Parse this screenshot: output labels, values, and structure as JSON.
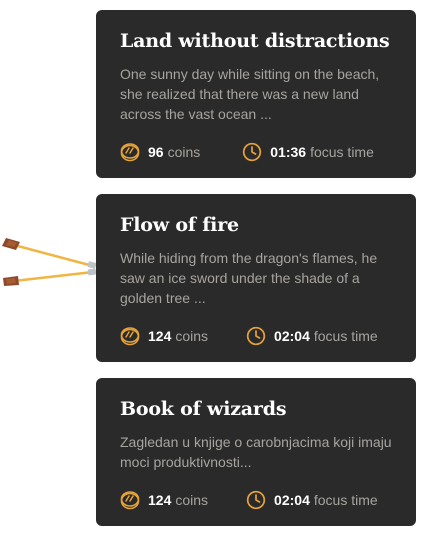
{
  "colors": {
    "card_background": "#2b2a2a",
    "title": "#ffffff",
    "description": "#a6a4a0",
    "accent_icon": "#e5a33a",
    "arrow_shaft": "#f0b542",
    "arrow_fletching": "#8b4a2b"
  },
  "decoration": {
    "icon": "arrows-icon"
  },
  "cards": [
    {
      "title": "Land without distractions",
      "description": "One sunny day while sitting on the beach, she realized that there was a new land across the vast ocean ...",
      "coins_value": "96",
      "coins_label": "coins",
      "coins_icon": "coin-icon",
      "time_value": "01:36",
      "time_label": "focus time",
      "time_icon": "clock-icon"
    },
    {
      "title": "Flow of fire",
      "description": "While hiding from the dragon's flames, he saw an ice sword under the shade of a golden tree ...",
      "coins_value": "124",
      "coins_label": "coins",
      "coins_icon": "coin-icon",
      "time_value": "02:04",
      "time_label": "focus time",
      "time_icon": "clock-icon"
    },
    {
      "title": "Book of wizards",
      "description": "Zagledan u knjige o carobnjacima koji imaju moci produktivnosti...",
      "coins_value": "124",
      "coins_label": "coins",
      "coins_icon": "coin-icon",
      "time_value": "02:04",
      "time_label": "focus time",
      "time_icon": "clock-icon"
    }
  ]
}
